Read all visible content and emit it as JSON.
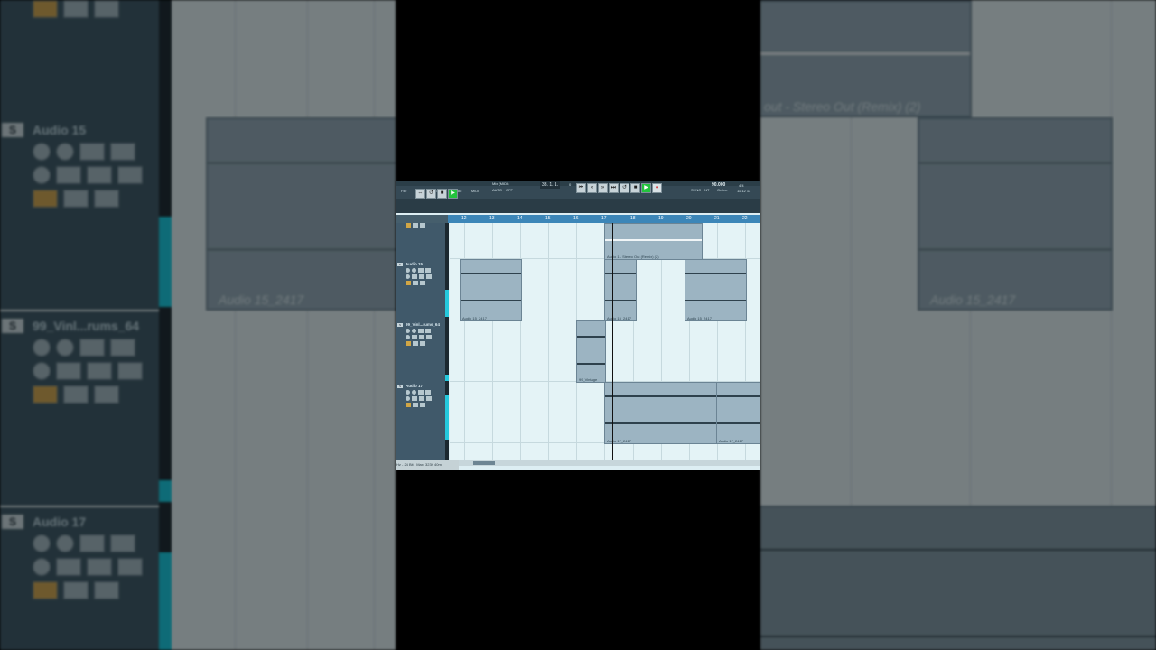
{
  "transport": {
    "menu_items": [
      "File",
      "Edit",
      "Project",
      "Audio",
      "MIDI"
    ],
    "mix_label": "Mix (MIDI)",
    "auto_label": "AUTO",
    "auto_value": "OFF",
    "position": "33. 1. 1.",
    "position_sub": "0",
    "tempo": "90.000",
    "sync": "SYNC",
    "sync_sub": "INT",
    "online": "Online",
    "time_sig": "4/4",
    "right_small": "11 12 13"
  },
  "ruler": {
    "bars": [
      "12",
      "13",
      "14",
      "15",
      "16",
      "17",
      "18",
      "19",
      "20",
      "21",
      "22"
    ]
  },
  "tracks": [
    {
      "s_label": "S",
      "name": "Audio 15"
    },
    {
      "s_label": "S",
      "name": "99_Vinl...rums_64"
    },
    {
      "s_label": "S",
      "name": "Audio 17"
    }
  ],
  "clips": {
    "stereo_out": "Audio 1 - Stereo Out (Remix) (2)",
    "audio15_a": "Audio 15_2417",
    "audio15_b": "Audio 15_2417",
    "audio15_c": "Audio 15_2417",
    "vinyl": "99_Vintage",
    "audio17_a": "Audio 17_2417",
    "audio17_b": "Audio 17_2417"
  },
  "status": {
    "text": "Hz - 24 Bit - Max: 323h 40m"
  },
  "background": {
    "left_tracks": [
      "Audio 15",
      "99_Vinl...rums_64",
      "Audio 17"
    ],
    "right_clip_label": "out - Stereo Out (Remix) (2)",
    "left_clip_label": "Audio 15_2417",
    "right_audio_label": "Audio 15_2417"
  },
  "colors": {
    "accent_play": "#23c33d",
    "record": "#d21b1b",
    "ruler": "#3c86b8",
    "meter": "#25c9dd"
  }
}
